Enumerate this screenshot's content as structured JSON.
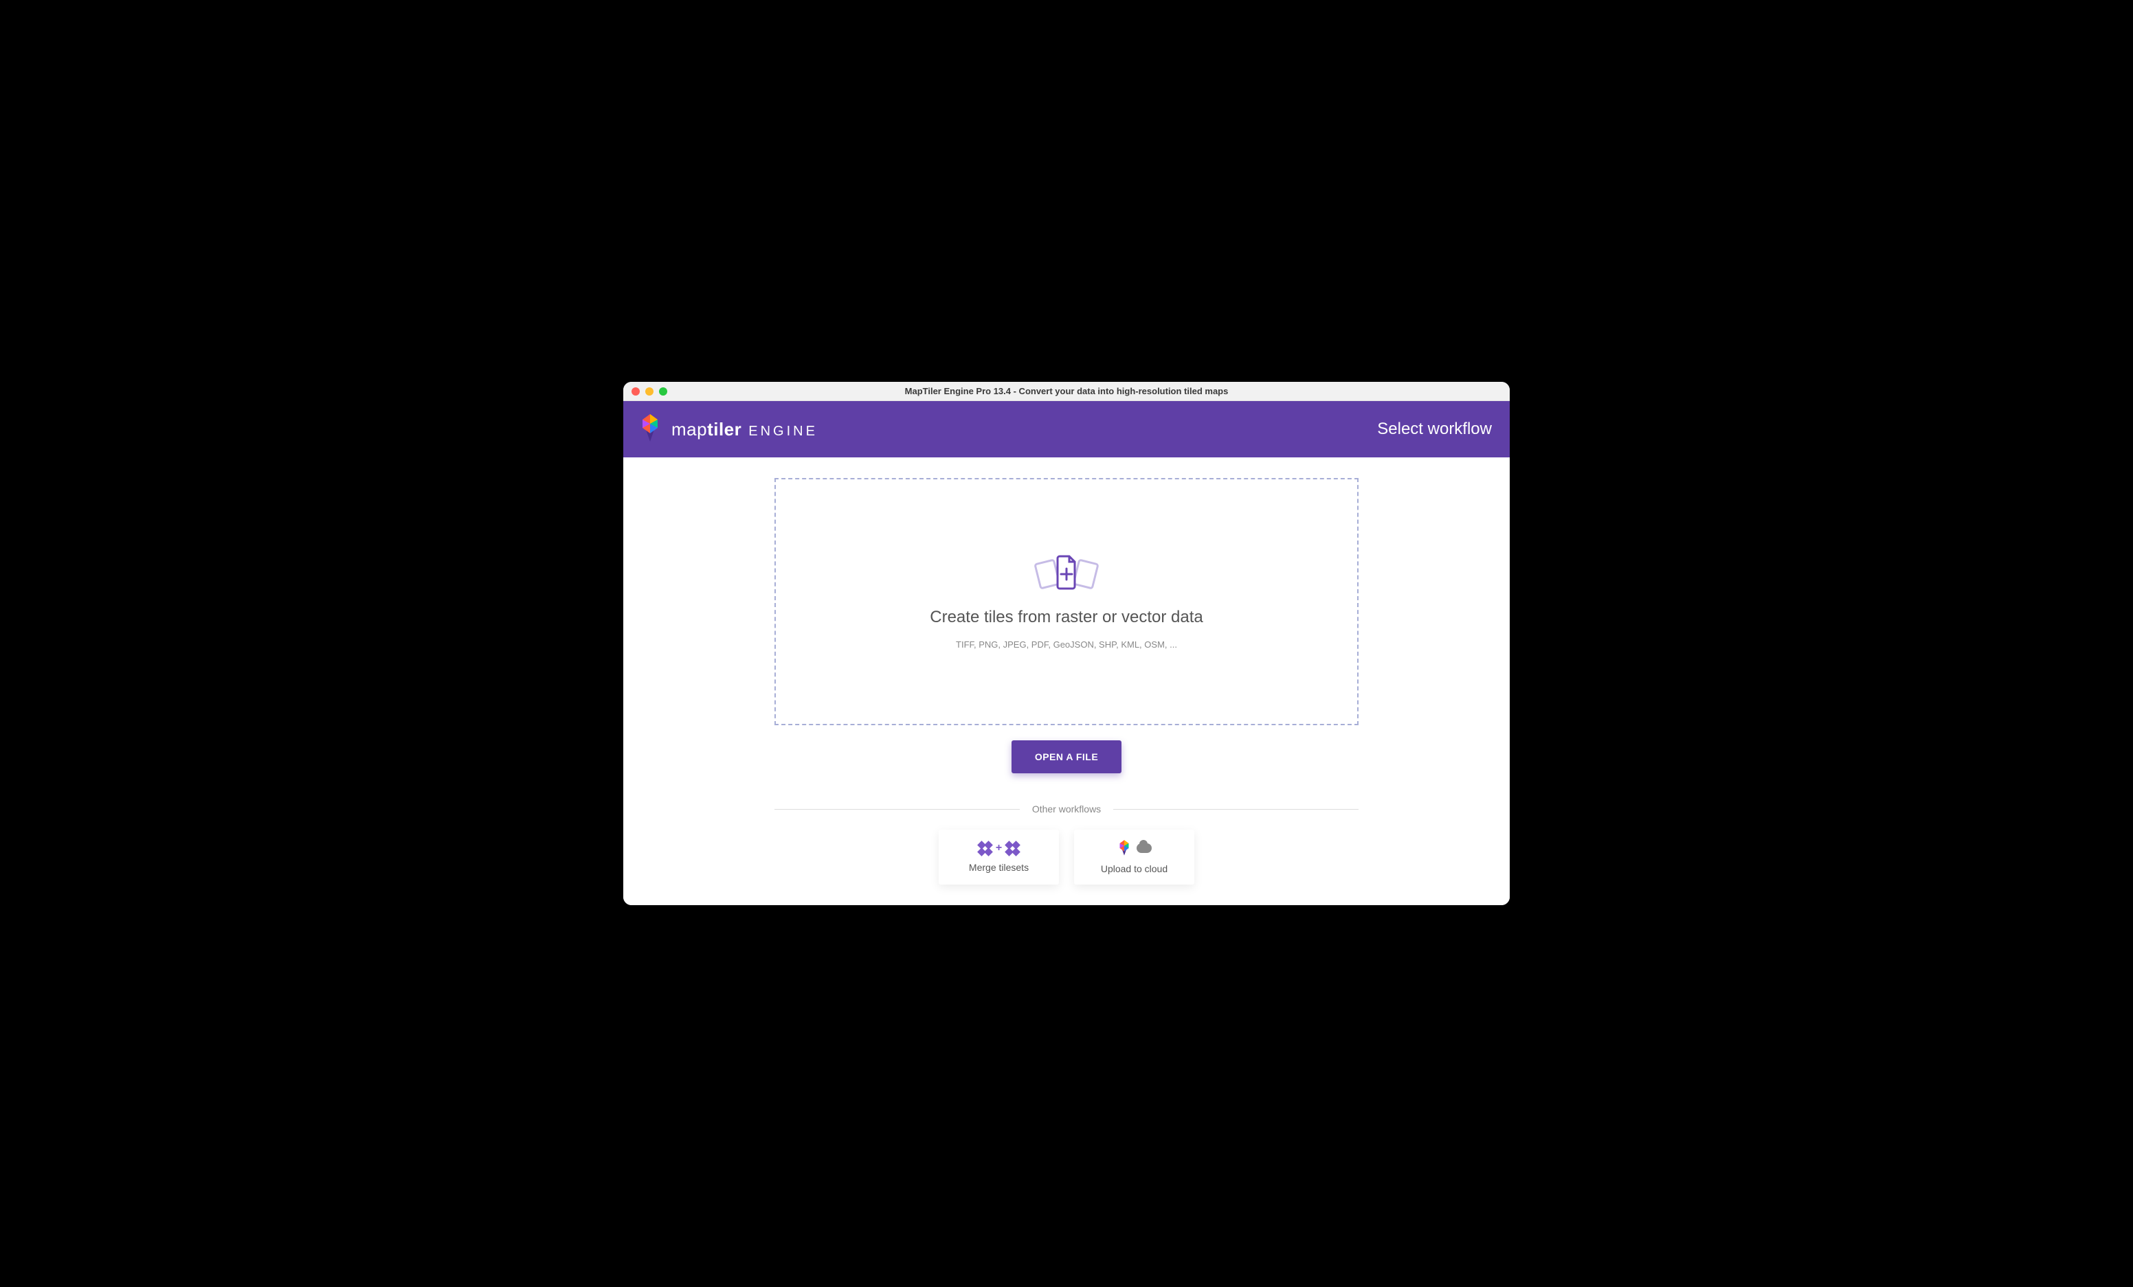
{
  "window": {
    "title": "MapTiler Engine Pro 13.4 - Convert your data into high-resolution tiled maps"
  },
  "header": {
    "brand_map_light": "map",
    "brand_map_bold": "tiler",
    "brand_engine": "ENGINE",
    "right_label": "Select workflow"
  },
  "dropzone": {
    "title": "Create tiles from raster or vector data",
    "subtitle": "TIFF, PNG, JPEG, PDF, GeoJSON, SHP, KML, OSM, ..."
  },
  "open_button": "OPEN A FILE",
  "other_workflows_label": "Other workflows",
  "cards": {
    "merge": "Merge tilesets",
    "upload": "Upload to cloud"
  }
}
